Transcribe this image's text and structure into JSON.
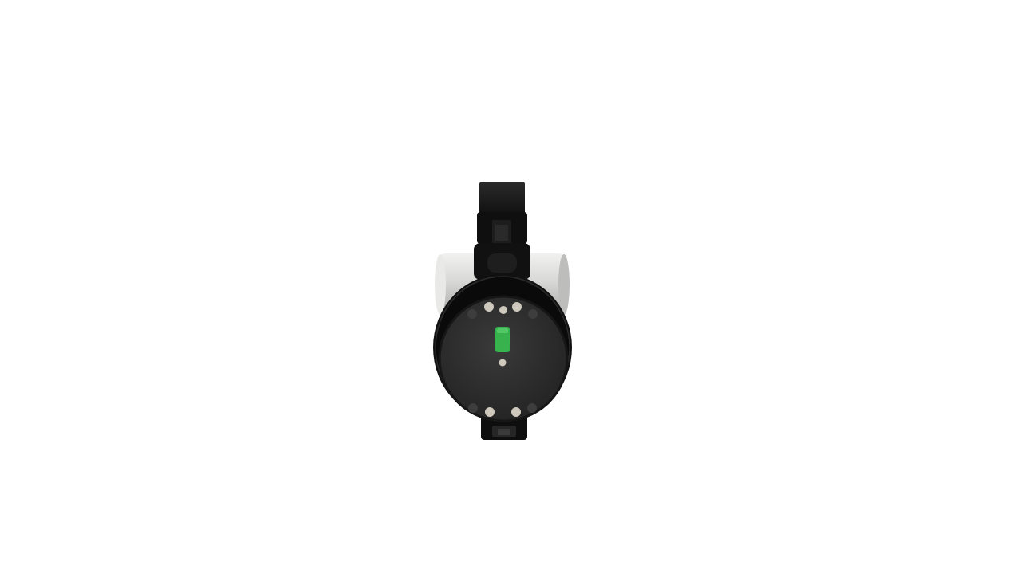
{
  "scene": {
    "background_color": "#ffffff",
    "subject": "robotic-joint-module",
    "colors": {
      "body": "#111111",
      "face_plate": "#2a2a2a",
      "shaft": "#d6d6d4",
      "status_led": "#37b24d",
      "pins": "#cfc9bd"
    },
    "status_led_state": "on"
  }
}
